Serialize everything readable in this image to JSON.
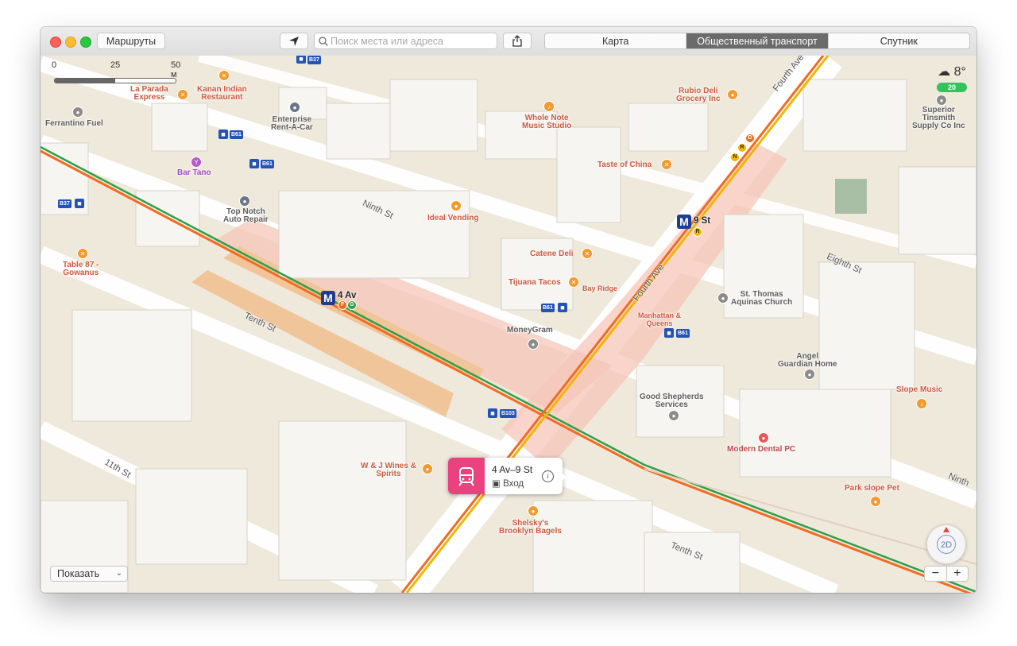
{
  "toolbar": {
    "routes_label": "Маршруты",
    "search_placeholder": "Поиск места или адреса",
    "tabs": [
      {
        "label": "Карта",
        "active": false
      },
      {
        "label": "Общественный транспорт",
        "active": true
      },
      {
        "label": "Спутник",
        "active": false
      }
    ]
  },
  "scale": {
    "labels": [
      "0",
      "25",
      "50 м"
    ]
  },
  "weather": {
    "temp": "8°",
    "aqi": "20",
    "icon": "cloud-icon"
  },
  "places": {
    "la_parada": "La Parada\nExpress",
    "kanan": "Kanan Indian\nRestaurant",
    "enterprise": "Enterprise\nRent-A-Car",
    "ferrantino": "Ferrantino Fuel",
    "bar_tano": "Bar Tano",
    "top_notch": "Top Notch\nAuto Repair",
    "table87": "Table 87 -\nGowanus",
    "whole_note": "Whole Note\nMusic Studio",
    "rubio": "Rubio Deli\nGrocery Inc",
    "superior": "Superior\nTinsmith\nSupply Co Inc",
    "taste_china": "Taste of China",
    "ideal": "Ideal Vending",
    "catene": "Catene Deli",
    "tijuana": "Tijuana Tacos",
    "bay_ridge": "Bay Ridge",
    "manhattan_queens": "Manhattan &\nQueens",
    "moneygram": "MoneyGram",
    "st_thomas": "St. Thomas\nAquinas Church",
    "angel": "Angel\nGuardian Home",
    "slope_music": "Slope Music",
    "good_shepherds": "Good Shepherds\nServices",
    "modern_dental": "Modern Dental PC",
    "park_slope_pet": "Park slope Pet",
    "wj_wines": "W & J Wines &\nSpirits",
    "shelskys": "Shelsky's\nBrooklyn Bagels"
  },
  "streets": {
    "ninth": "Ninth St",
    "tenth": "Tenth St",
    "eleventh": "11th St",
    "eighth": "Eighth St",
    "fourth_ave_1": "Fourth Ave",
    "fourth_ave_2": "Fourth Ave",
    "tenth_2": "Tenth St",
    "ninth_2": "Ninth"
  },
  "transit": {
    "station_4av": "4 Av",
    "station_9st": "9 St",
    "metro_letter": "M",
    "bus_routes": [
      "B37",
      "B61",
      "B61",
      "B37",
      "B61",
      "B61",
      "B103"
    ],
    "lines_4av": [
      "F",
      "G"
    ],
    "lines_9st": [
      "D",
      "R",
      "N",
      "R"
    ]
  },
  "popup": {
    "title": "4 Av–9 St",
    "subtitle": "Вход",
    "info_icon": "info-icon"
  },
  "controls": {
    "show_label": "Показать",
    "compass_label": "2D",
    "zoom_out": "−",
    "zoom_in": "+"
  },
  "colors": {
    "line_orange": "#f26b22",
    "line_green": "#2e9f46",
    "line_yellow": "#f5b400",
    "metro_blue": "#1e3f8f",
    "bus_blue": "#2453b8",
    "poi_orange": "#f29a2e",
    "popup_pink": "#e9427f"
  }
}
